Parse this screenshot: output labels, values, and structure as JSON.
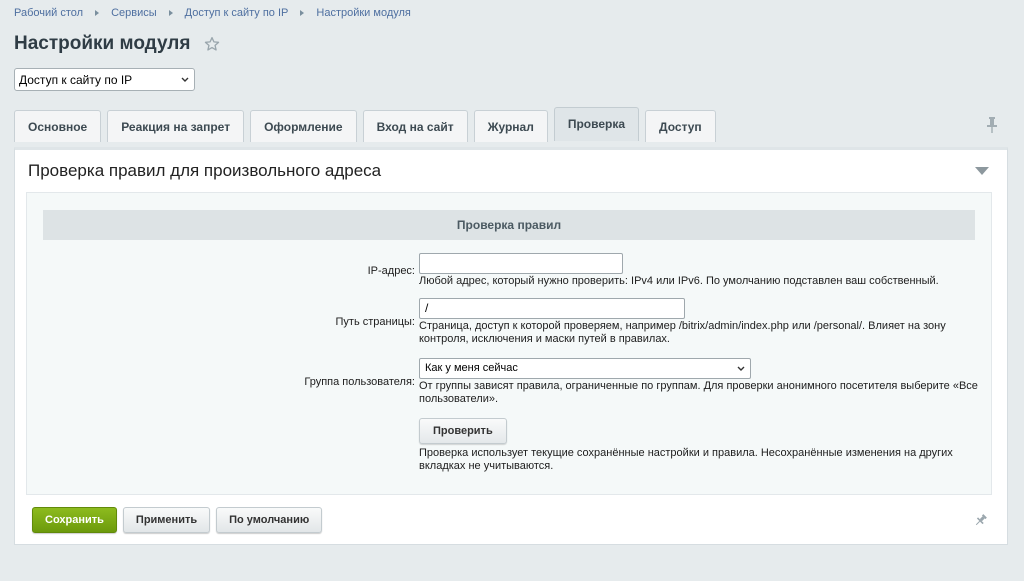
{
  "breadcrumbs": [
    "Рабочий стол",
    "Сервисы",
    "Доступ к сайту по IP",
    "Настройки модуля"
  ],
  "page": {
    "title": "Настройки модуля"
  },
  "module_select": {
    "value": "Доступ к сайту по IP"
  },
  "tabs": [
    {
      "label": "Основное"
    },
    {
      "label": "Реакция на запрет"
    },
    {
      "label": "Оформление"
    },
    {
      "label": "Вход на сайт"
    },
    {
      "label": "Журнал"
    },
    {
      "label": "Проверка",
      "active": true
    },
    {
      "label": "Доступ"
    }
  ],
  "panel": {
    "title": "Проверка правил для произвольного адреса",
    "section_title": "Проверка правил"
  },
  "form": {
    "ip": {
      "label": "IP-адрес:",
      "value": "",
      "hint": "Любой адрес, который нужно проверить: IPv4 или IPv6. По умолчанию подставлен ваш собственный."
    },
    "path": {
      "label": "Путь страницы:",
      "value": "/",
      "hint": "Страница, доступ к которой проверяем, например /bitrix/admin/index.php или /personal/. Влияет на зону контроля, исключения и маски путей в правилах."
    },
    "group": {
      "label": "Группа пользователя:",
      "value": "Как у меня сейчас",
      "hint": "От группы зависят правила, ограниченные по группам. Для проверки анонимного посетителя выберите «Все пользователи»."
    },
    "check": {
      "label": "Проверить",
      "hint": "Проверка использует текущие сохранённые настройки и правила. Несохранённые изменения на других вкладках не учитываются."
    }
  },
  "footer": {
    "save": "Сохранить",
    "apply": "Применить",
    "default": "По умолчанию"
  },
  "colors": {
    "accent": "#7aab12",
    "link": "#4e6fa0"
  },
  "icons": [
    "star-icon",
    "chevron-down-icon",
    "pin-icon",
    "collapse-icon"
  ]
}
